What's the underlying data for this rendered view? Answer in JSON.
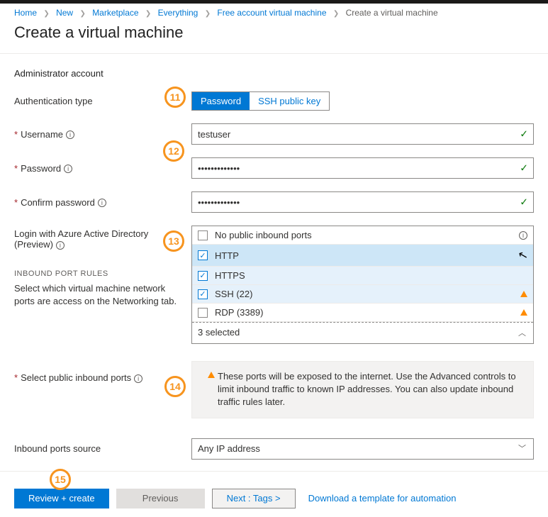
{
  "breadcrumb": {
    "items": [
      "Home",
      "New",
      "Marketplace",
      "Everything",
      "Free account virtual machine"
    ],
    "current": "Create a virtual machine"
  },
  "title": "Create a virtual machine",
  "section": "Administrator account",
  "labels": {
    "auth_type": "Authentication type",
    "username": "Username",
    "password": "Password",
    "confirm": "Confirm password",
    "login_aad": "Login with Azure Active Directory (Preview)",
    "inbound_title": "INBOUND PORT RULES",
    "inbound_desc": "Select which virtual machine network ports are access on the Networking tab.",
    "select_ports": "Select public inbound ports",
    "ports_source": "Inbound ports source"
  },
  "auth": {
    "password": "Password",
    "ssh": "SSH public key"
  },
  "values": {
    "username": "testuser",
    "password": "•••••••••••••",
    "confirm": "•••••••••••••",
    "ports_summary": "3 selected",
    "ports_source": "Any IP address"
  },
  "ports": {
    "none": "No public inbound ports",
    "http": "HTTP",
    "https": "HTTPS",
    "ssh": "SSH (22)",
    "rdp": "RDP (3389)"
  },
  "warning": "These ports will be exposed to the internet. Use the Advanced controls to limit inbound traffic to known IP addresses. You can also update inbound traffic rules later.",
  "footer": {
    "review": "Review + create",
    "previous": "Previous",
    "next": "Next : Tags >",
    "download": "Download a template for automation"
  },
  "badges": {
    "b11": "11",
    "b12": "12",
    "b13": "13",
    "b14": "14",
    "b15": "15"
  }
}
